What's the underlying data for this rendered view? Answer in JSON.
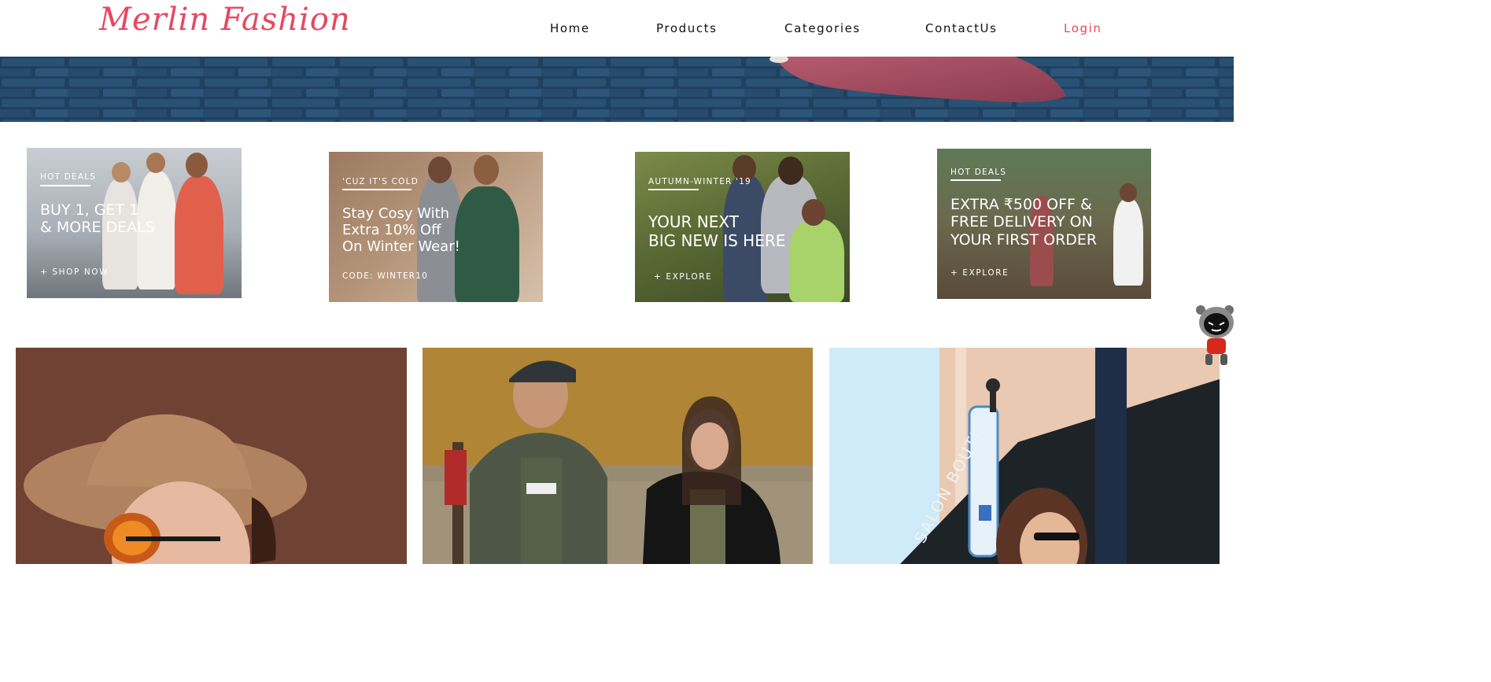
{
  "navbar": {
    "brand": "Merlin Fashion",
    "items": [
      {
        "label": "Home"
      },
      {
        "label": "Products"
      },
      {
        "label": "Categories"
      },
      {
        "label": "ContactUs"
      },
      {
        "label": "Login"
      }
    ],
    "accent_color": "#e8475f"
  },
  "promos": [
    {
      "tag": "HOT DEALS",
      "headline_1": "BUY 1, GET 1",
      "headline_2": "& MORE DEALS",
      "cta": "+ SHOP NOW"
    },
    {
      "tag": "'CUZ IT'S COLD",
      "headline_1": "Stay Cosy With",
      "headline_2": "Extra 10% Off",
      "headline_3": "On Winter Wear!",
      "cta": "CODE: WINTER10"
    },
    {
      "tag": "AUTUMN-WINTER '19",
      "headline_1": "YOUR NEXT",
      "headline_2": "BIG NEW IS HERE",
      "cta": "+ EXPLORE"
    },
    {
      "tag": "HOT DEALS",
      "headline_1": "EXTRA ₹500 OFF &",
      "headline_2": "FREE DELIVERY ON",
      "headline_3": "YOUR FIRST ORDER",
      "cta": "+ EXPLORE"
    }
  ],
  "cards": [
    {
      "icon": "woman-in-hat-photo"
    },
    {
      "icon": "couple-in-jackets-photo"
    },
    {
      "icon": "woman-at-storefront-photo",
      "sign_text": "SALON BOUTI"
    }
  ],
  "mascot": {
    "icon": "robot-mascot-icon"
  }
}
